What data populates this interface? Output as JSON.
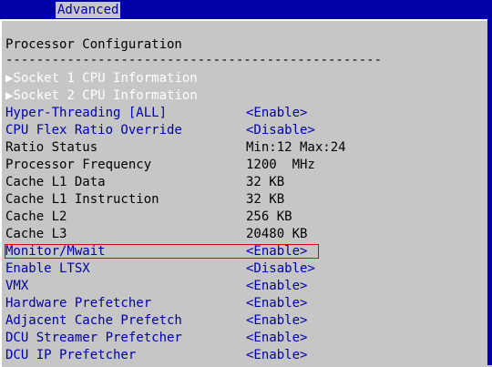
{
  "header": {
    "active_tab": "Advanced"
  },
  "page": {
    "title": "Processor Configuration",
    "rule": "-------------------------------------------------"
  },
  "submenus": [
    {
      "arrow": "▶",
      "label": "Socket 1 CPU Information"
    },
    {
      "arrow": "▶",
      "label": "Socket 2 CPU Information"
    }
  ],
  "settings": [
    {
      "label": "Hyper-Threading [ALL]",
      "value": "<Enable>"
    },
    {
      "label": "CPU Flex Ratio Override",
      "value": "<Disable>"
    }
  ],
  "info": [
    {
      "label": "Ratio Status",
      "value": "Min:12 Max:24"
    },
    {
      "label": "Processor Frequency",
      "value": "1200  MHz"
    },
    {
      "label": "Cache L1 Data",
      "value": "32 KB"
    },
    {
      "label": "Cache L1 Instruction",
      "value": "32 KB"
    },
    {
      "label": "Cache L2",
      "value": "256 KB"
    },
    {
      "label": "Cache L3",
      "value": "20480 KB"
    }
  ],
  "settings2": [
    {
      "label": "Monitor/Mwait",
      "value": "<Enable>"
    },
    {
      "label": "Enable LTSX",
      "value": "<Disable>"
    },
    {
      "label": "VMX",
      "value": "<Enable>"
    },
    {
      "label": "Hardware Prefetcher",
      "value": "<Enable>"
    },
    {
      "label": "Adjacent Cache Prefetch",
      "value": "<Enable>"
    },
    {
      "label": "DCU Streamer Prefetcher",
      "value": "<Enable>"
    },
    {
      "label": "DCU IP Prefetcher",
      "value": "<Enable>"
    }
  ],
  "colors": {
    "bios_blue": "#0000a8",
    "bios_gray": "#c6c6c6",
    "highlight_red": "#e00000"
  }
}
